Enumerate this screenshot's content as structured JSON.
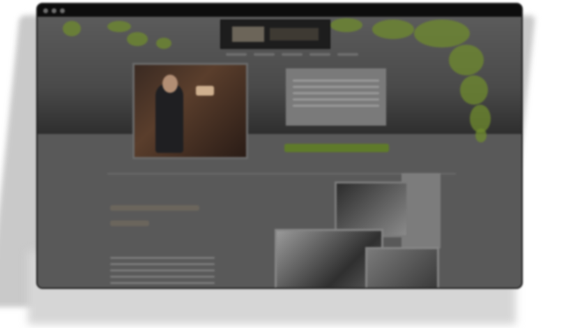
{
  "window": {
    "controls": [
      "close",
      "minimize",
      "maximize"
    ]
  },
  "site": {
    "logo_text": "",
    "nav_items": [
      "",
      "",
      "",
      "",
      ""
    ],
    "hero_text_lines": [
      "",
      "",
      "",
      "",
      ""
    ],
    "cta_label": "",
    "section_heading": "",
    "paragraph_lines": [
      "",
      "",
      "",
      "",
      ""
    ]
  },
  "colors": {
    "accent_green": "#5f7a2a",
    "vine_green": "#6f8b2e",
    "heading_brown": "#8c7a62"
  }
}
